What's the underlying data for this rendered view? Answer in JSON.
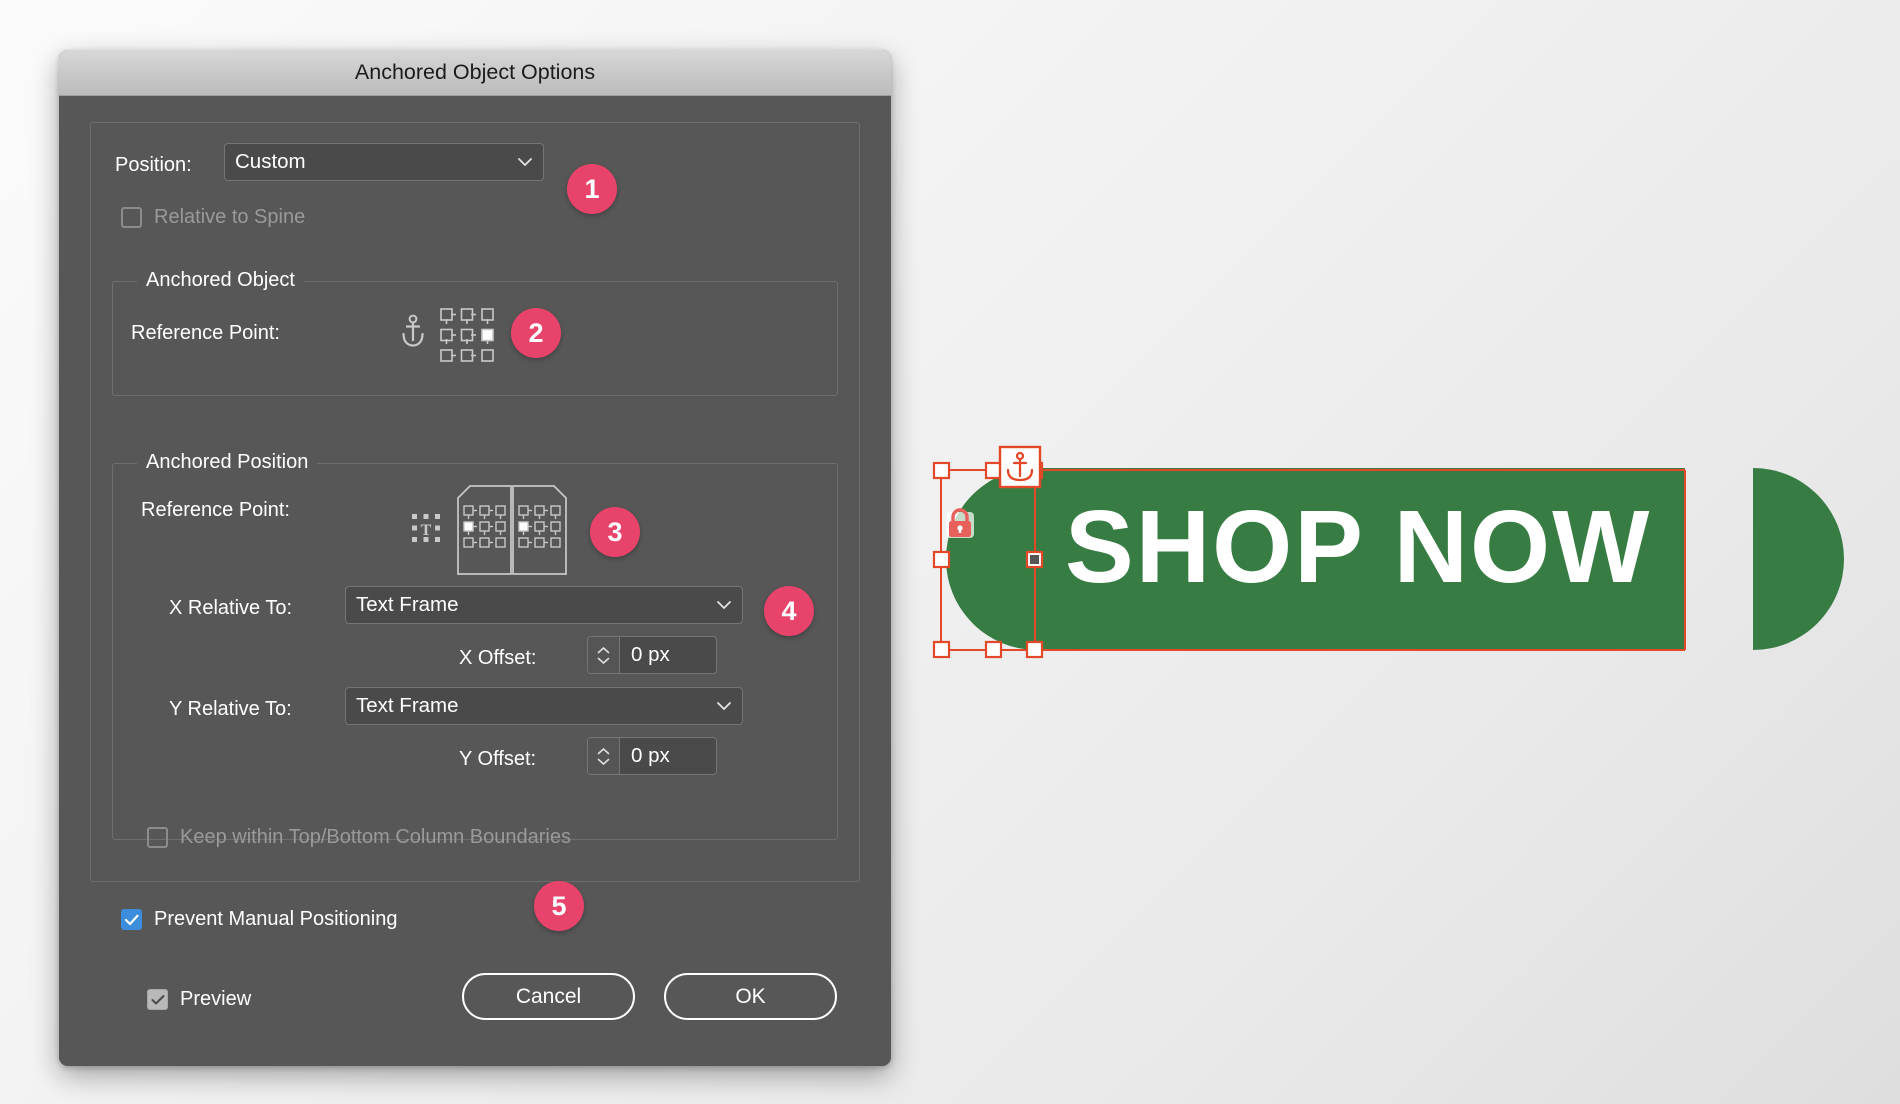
{
  "dialog": {
    "title": "Anchored Object Options",
    "position_label": "Position:",
    "position_value": "Custom",
    "relative_to_spine_label": "Relative to Spine",
    "anchored_object": {
      "legend": "Anchored Object",
      "reference_point_label": "Reference Point:"
    },
    "anchored_position": {
      "legend": "Anchored Position",
      "reference_point_label": "Reference Point:",
      "x_relative_label": "X Relative To:",
      "x_relative_value": "Text Frame",
      "x_offset_label": "X Offset:",
      "x_offset_value": "0 px",
      "y_relative_label": "Y Relative To:",
      "y_relative_value": "Text Frame",
      "y_offset_label": "Y Offset:",
      "y_offset_value": "0 px",
      "keep_within_label": "Keep within Top/Bottom Column Boundaries"
    },
    "prevent_manual_label": "Prevent Manual Positioning",
    "preview_label": "Preview",
    "cancel_label": "Cancel",
    "ok_label": "OK"
  },
  "callouts": [
    {
      "num": "1"
    },
    {
      "num": "2"
    },
    {
      "num": "3"
    },
    {
      "num": "4"
    },
    {
      "num": "5"
    }
  ],
  "artwork": {
    "button_text": "SHOP NOW",
    "green": "#377D43",
    "selection_color": "#E34828",
    "anchor_icon": "anchor-icon",
    "lock_icon": "lock-icon"
  },
  "colors": {
    "badge": "#E8436B",
    "checkbox_blue": "#3c8ddc",
    "dialog_bg": "#575757",
    "titlebar": "#c9c9c9"
  }
}
